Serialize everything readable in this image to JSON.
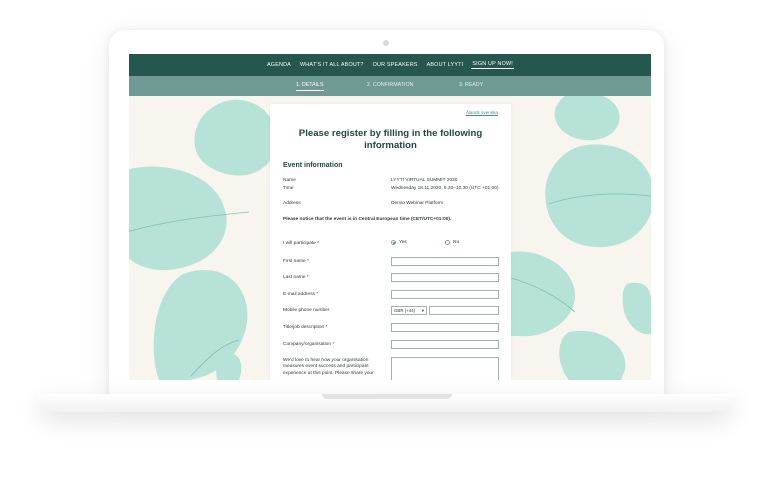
{
  "nav": {
    "items": [
      "AGENDA",
      "WHAT'S IT ALL ABOUT?",
      "OUR SPEAKERS",
      "ABOUT LYYTI",
      "SIGN UP NOW!"
    ],
    "active_index": 4
  },
  "steps": {
    "items": [
      "1. DETAILS",
      "2. CONFIRMATION",
      "3. READY"
    ],
    "active_index": 0
  },
  "form": {
    "language_link": "Ålands svenska",
    "title": "Please register by filling in the following information",
    "section_title": "Event information",
    "event": {
      "name_label": "Name",
      "name_value": "LYYTI VIRTUAL SUMMIT 2020",
      "time_label": "Time",
      "time_value": "Wednesday 18.11.2020, 9.30–10.30 (UTC +01:00)",
      "address_label": "Address",
      "address_value": "Demio Webinar Platform"
    },
    "notice": "Please notice that the event is in Central European time (CET/UTC+01:00).",
    "participate": {
      "label": "I will participate *",
      "yes": "Yes",
      "no": "No",
      "selected": "Yes"
    },
    "fields": {
      "first_name": "First name *",
      "last_name": "Last name *",
      "email": "E-mail address *",
      "mobile": "Mobile phone number",
      "mobile_country": "GBR (+44)",
      "title": "Title/job description *",
      "company": "Company/organisation *",
      "feedback": "We'd love to hear how your organisation measures event success and participant experience at this point. Please share your"
    }
  },
  "colors": {
    "nav_bg": "#25574e",
    "steps_bg": "#6f9a93",
    "blob": "#b7e2d8",
    "title": "#1e4841"
  },
  "icons": {
    "select_chevron": "chevron-down-icon"
  }
}
